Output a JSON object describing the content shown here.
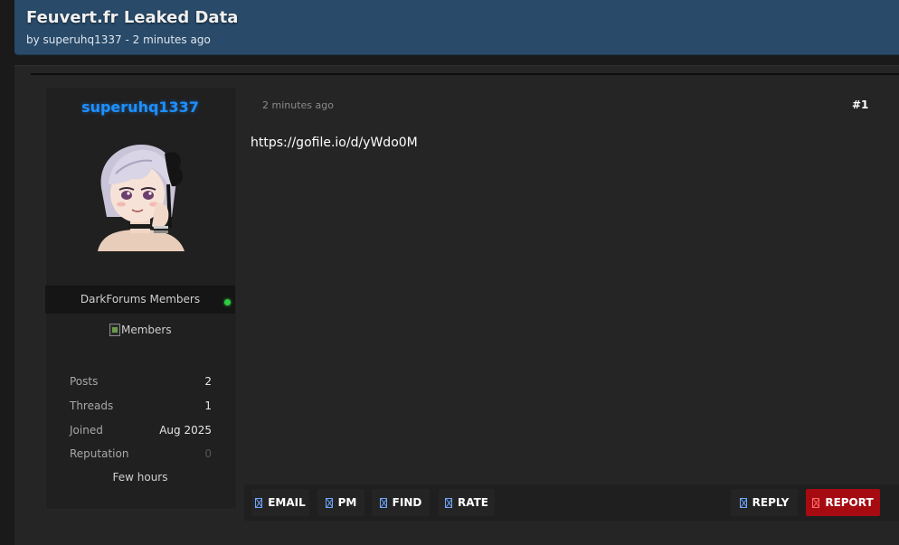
{
  "thread": {
    "title": "Feuvert.fr Leaked Data",
    "byline": "by superuhq1337 - 2 minutes ago"
  },
  "user": {
    "username": "superuhq1337",
    "avatar_icon": "anime-avatar",
    "usergroup": "DarkForums Members",
    "online_status_color": "#2ecc40",
    "rank_image_alt": "Members",
    "stats": [
      {
        "label": "Posts",
        "value": "2"
      },
      {
        "label": "Threads",
        "value": "1"
      },
      {
        "label": "Joined",
        "value": "Aug 2025"
      },
      {
        "label": "Reputation",
        "value": "0"
      }
    ],
    "last_active": "Few hours"
  },
  "post": {
    "date": "2 minutes ago",
    "number": "#1",
    "body": "https://gofile.io/d/yWdo0M"
  },
  "actions": {
    "email": "EMAIL",
    "pm": "PM",
    "find": "FIND",
    "rate": "RATE",
    "reply": "REPLY",
    "report": "REPORT"
  },
  "colors": {
    "header": "#294a69",
    "username": "#1e90ff",
    "report": "#a60b12"
  }
}
